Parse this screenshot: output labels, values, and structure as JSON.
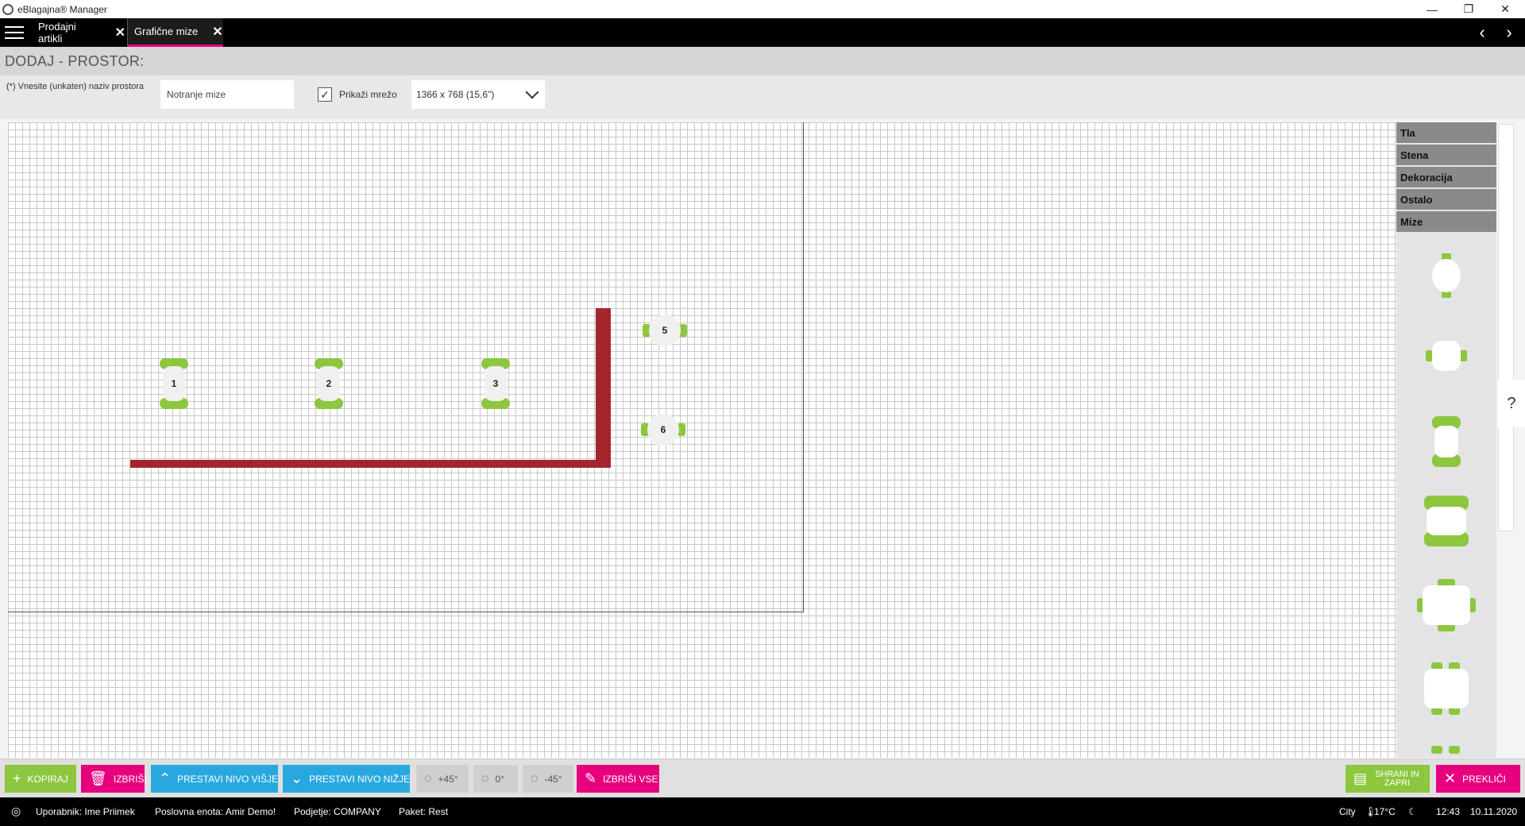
{
  "window": {
    "title": "eBlagajna® Manager",
    "minimize_glyph": "—",
    "maximize_glyph": "❐",
    "close_glyph": "✕"
  },
  "tabs": [
    {
      "label": "Prodajni artikli",
      "close": "✕",
      "active": false
    },
    {
      "label": "Grafične mize",
      "close": "✕",
      "active": true
    }
  ],
  "nav": {
    "back": "‹",
    "forward": "›"
  },
  "page": {
    "title": "DODAJ - PROSTOR:"
  },
  "form": {
    "name_label": "(*) Vnesite (unkaten) naziv prostora",
    "name_value": "Notranje mize",
    "grid_checkbox_label": "Prikaži mrežo",
    "grid_checked": true,
    "check_glyph": "✓",
    "resolution_value": "1366 x 768 (15,6\")"
  },
  "tables": [
    {
      "number": "1",
      "shape": "rect"
    },
    {
      "number": "2",
      "shape": "rect"
    },
    {
      "number": "3",
      "shape": "rect"
    },
    {
      "number": "5",
      "shape": "round"
    },
    {
      "number": "6",
      "shape": "round"
    }
  ],
  "palette": {
    "categories": [
      "Tla",
      "Stena",
      "Dekoracija",
      "Ostalo",
      "Mize"
    ]
  },
  "help_label": "?",
  "toolbar": {
    "copy": "KOPIRAJ",
    "delete": "IZBRIŠI",
    "level_up": "PRESTAVI NIVO VIŠJE",
    "level_down": "PRESTAVI NIVO NIŽJE",
    "rotate_plus": "+45°",
    "rotate_zero": "0°",
    "rotate_minus": "-45°",
    "delete_all": "IZBRIŠI VSE",
    "save_close_line1": "SHRANI IN",
    "save_close_line2": "ZAPRI",
    "cancel": "PREKLIČI",
    "icons": {
      "copy": "+",
      "delete": "🗑",
      "level_up": "⌃",
      "level_down": "⌄",
      "rotate": "◌",
      "delete_all": "✎",
      "save": "▤",
      "cancel": "✕"
    }
  },
  "status": {
    "user": "Uporabnik: Ime Priimek",
    "unit": "Poslovna enota: Amir Demo!",
    "company": "Podjetje: COMPANY",
    "package": "Paket: Rest",
    "city": "City",
    "temperature": "17°C",
    "time": "12:43",
    "date": "10.11.2020"
  },
  "colors": {
    "accent_green": "#8dc63f",
    "accent_pink": "#e6007e",
    "accent_blue": "#29a8e0",
    "wall": "#a4262c"
  }
}
